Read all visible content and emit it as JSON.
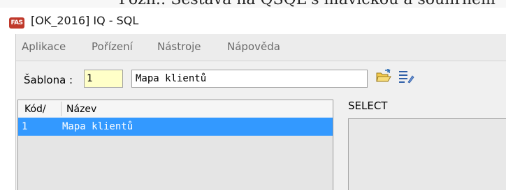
{
  "window": {
    "title": "[OK_2016] IQ - SQL",
    "logo_text": "FAS",
    "background_doc_text": "Pozn.: Sestava na QSQL s hlavičkou a souhrnem"
  },
  "menu": {
    "items": [
      {
        "label": "Aplikace"
      },
      {
        "label": "Pořízení"
      },
      {
        "label": "Nástroje"
      },
      {
        "label": "Nápověda"
      }
    ]
  },
  "template": {
    "label": "Šablona :",
    "code_value": "1",
    "name_value": "Mapa klientů"
  },
  "toolbar": {
    "open_icon": "folder-open-icon",
    "list_icon": "list-edit-icon"
  },
  "grid": {
    "columns": [
      "Kód/",
      "Název"
    ],
    "rows": [
      {
        "code": "1",
        "name": "Mapa klientů",
        "selected": true
      }
    ]
  },
  "sql_panel": {
    "label": "SELECT"
  },
  "colors": {
    "selection": "#3399ff",
    "code_input_bg": "#ffffc8",
    "logo": "#c0392b"
  }
}
